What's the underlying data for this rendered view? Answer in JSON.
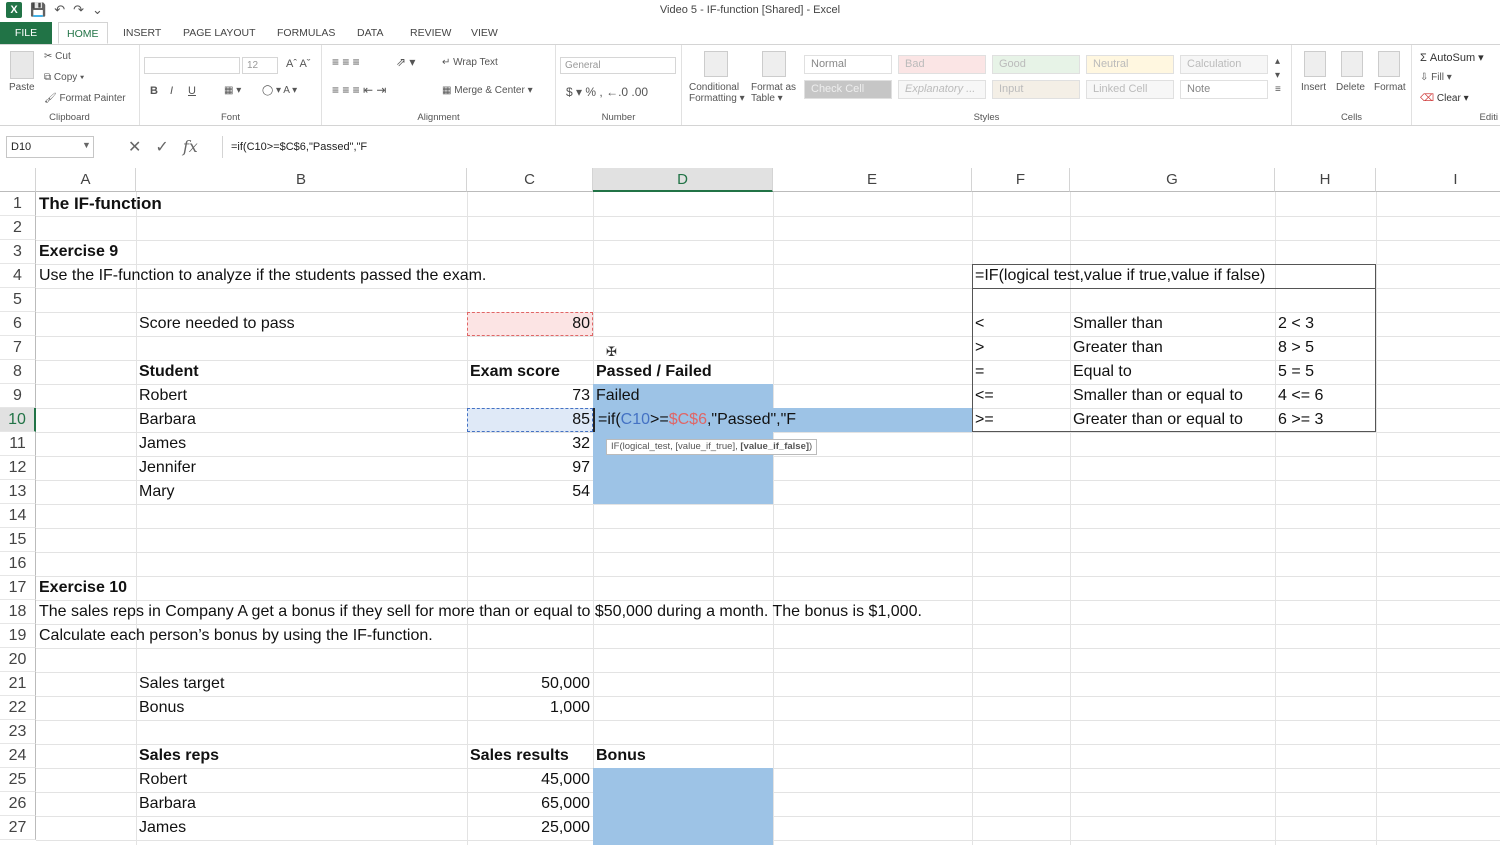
{
  "titlebar": {
    "title": "Video 5 - IF-function  [Shared] - Excel",
    "app_icon": "X"
  },
  "tabs": [
    "FILE",
    "HOME",
    "INSERT",
    "PAGE LAYOUT",
    "FORMULAS",
    "DATA",
    "REVIEW",
    "VIEW"
  ],
  "ribbon": {
    "clipboard": {
      "paste": "Paste",
      "cut": "Cut",
      "copy": "Copy",
      "format_painter": "Format Painter",
      "label": "Clipboard"
    },
    "font": {
      "size": "12",
      "bold": "B",
      "italic": "I",
      "underline": "U",
      "label": "Font"
    },
    "alignment": {
      "wrap": "Wrap Text",
      "merge": "Merge & Center",
      "label": "Alignment"
    },
    "number": {
      "format": "General",
      "currency": "$",
      "percent": "%",
      "label": "Number"
    },
    "styles": {
      "conditional": "Conditional",
      "conditional2": "Formatting",
      "format_as": "Format as",
      "format_as2": "Table",
      "cells": [
        "Normal",
        "Bad",
        "Good",
        "Neutral",
        "Calculation",
        "Check Cell",
        "Explanatory ...",
        "Input",
        "Linked Cell",
        "Note"
      ],
      "label": "Styles"
    },
    "cells": {
      "insert": "Insert",
      "delete": "Delete",
      "format": "Format",
      "label": "Cells"
    },
    "editing": {
      "autosum": "AutoSum",
      "fill": "Fill",
      "clear": "Clear",
      "label": "Editi"
    }
  },
  "formula_bar": {
    "name_box": "D10",
    "formula": "=if(C10>=$C$6,\"Passed\",\"F"
  },
  "columns": [
    "A",
    "B",
    "C",
    "D",
    "E",
    "F",
    "G",
    "H",
    "I"
  ],
  "rows": [
    "1",
    "2",
    "3",
    "4",
    "5",
    "6",
    "7",
    "8",
    "9",
    "10",
    "11",
    "12",
    "13",
    "14",
    "15",
    "16",
    "17",
    "18",
    "19",
    "20",
    "21",
    "22",
    "23",
    "24",
    "25",
    "26",
    "27"
  ],
  "cells": {
    "a1": "The IF-function",
    "a3": "Exercise 9",
    "a4": "Use the IF-function to analyze if the students passed the exam.",
    "b6": "Score needed to pass",
    "c6": "80",
    "b8": "Student",
    "c8": "Exam score",
    "d8": "Passed / Failed",
    "students": [
      {
        "name": "Robert",
        "score": "73",
        "result": "Failed"
      },
      {
        "name": "Barbara",
        "score": "85",
        "result": ""
      },
      {
        "name": "James",
        "score": "32",
        "result": ""
      },
      {
        "name": "Jennifer",
        "score": "97",
        "result": ""
      },
      {
        "name": "Mary",
        "score": "54",
        "result": ""
      }
    ],
    "d10_edit": {
      "p1": "=if(",
      "p2": "C10",
      "p3": ">=",
      "p4": "$C$6",
      "p5": ",\"Passed\",\"F"
    },
    "tooltip": {
      "p1": "IF(logical_test, [value_if_true], ",
      "p2": "[value_if_false]",
      "p3": ")"
    },
    "f4": "=IF(logical test,value if true,value if false)",
    "ops": [
      {
        "op": "<",
        "desc": "Smaller than",
        "ex": "2 < 3"
      },
      {
        "op": ">",
        "desc": "Greater than",
        "ex": "8 > 5"
      },
      {
        "op": "=",
        "desc": "Equal to",
        "ex": "5 = 5"
      },
      {
        "op": "<=",
        "desc": "Smaller than or equal to",
        "ex": "4 <= 6"
      },
      {
        "op": ">=",
        "desc": "Greater than or equal to",
        "ex": "6 >= 3"
      }
    ],
    "a17": "Exercise 10",
    "a18": "The sales reps in Company A get a bonus if they sell for more than or equal to $50,000 during a month. The bonus is $1,000.",
    "a19": "Calculate each person’s bonus by using the IF-function.",
    "b21": "Sales target",
    "c21": "50,000",
    "b22": "Bonus",
    "c22": "1,000",
    "b24": "Sales reps",
    "c24": "Sales results",
    "d24": "Bonus",
    "reps": [
      {
        "name": "Robert",
        "result": "45,000"
      },
      {
        "name": "Barbara",
        "result": "65,000"
      },
      {
        "name": "James",
        "result": "25,000"
      }
    ]
  },
  "colors": {
    "excel_green": "#217346",
    "selection_blue": "#9dc3e6",
    "ref_blue": "#4472c4",
    "ref_red": "#e06666"
  }
}
